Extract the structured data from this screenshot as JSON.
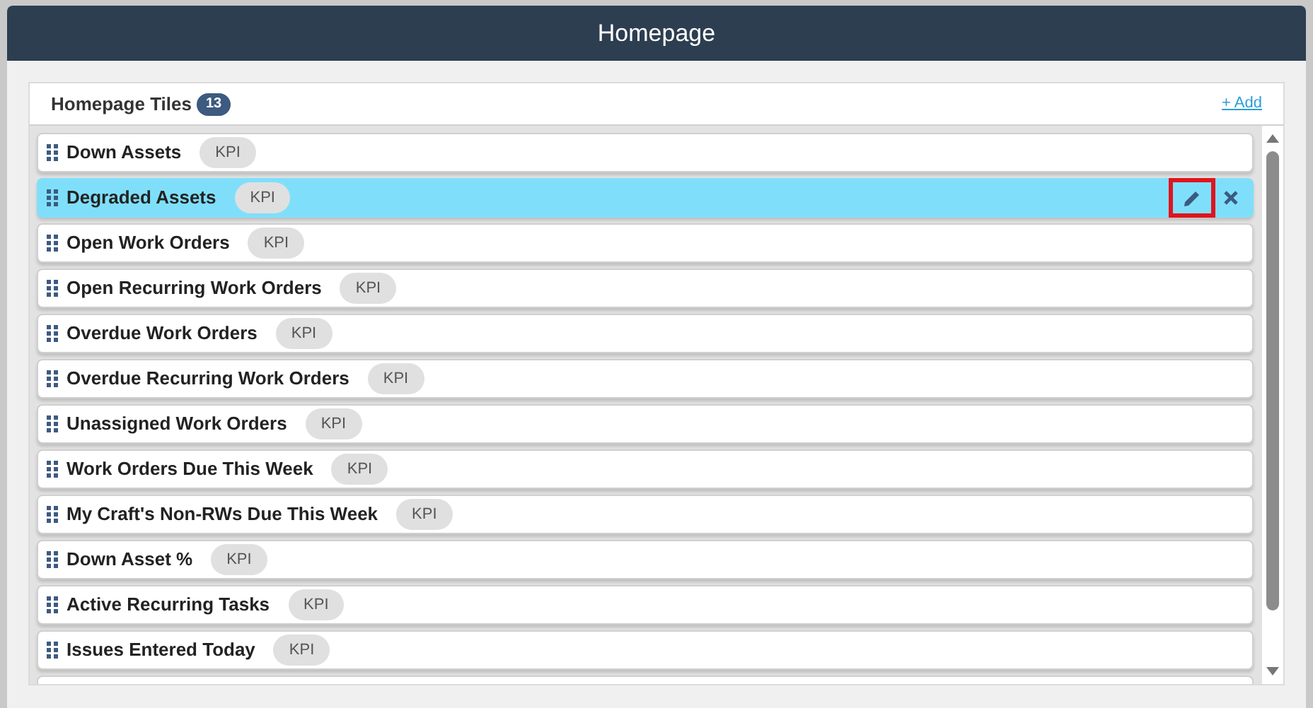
{
  "window": {
    "title": "Homepage"
  },
  "panel": {
    "title": "Homepage Tiles",
    "count": "13",
    "add_link": "+ Add"
  },
  "tiles": [
    {
      "name": "Down Assets",
      "tag": "KPI",
      "selected": false
    },
    {
      "name": "Degraded Assets",
      "tag": "KPI",
      "selected": true
    },
    {
      "name": "Open Work Orders",
      "tag": "KPI",
      "selected": false
    },
    {
      "name": "Open Recurring Work Orders",
      "tag": "KPI",
      "selected": false
    },
    {
      "name": "Overdue Work Orders",
      "tag": "KPI",
      "selected": false
    },
    {
      "name": "Overdue Recurring Work Orders",
      "tag": "KPI",
      "selected": false
    },
    {
      "name": "Unassigned Work Orders",
      "tag": "KPI",
      "selected": false
    },
    {
      "name": "Work Orders Due This Week",
      "tag": "KPI",
      "selected": false
    },
    {
      "name": "My Craft's Non-RWs Due This Week",
      "tag": "KPI",
      "selected": false
    },
    {
      "name": "Down Asset %",
      "tag": "KPI",
      "selected": false
    },
    {
      "name": "Active Recurring Tasks",
      "tag": "KPI",
      "selected": false
    },
    {
      "name": "Issues Entered Today",
      "tag": "KPI",
      "selected": false
    }
  ]
}
